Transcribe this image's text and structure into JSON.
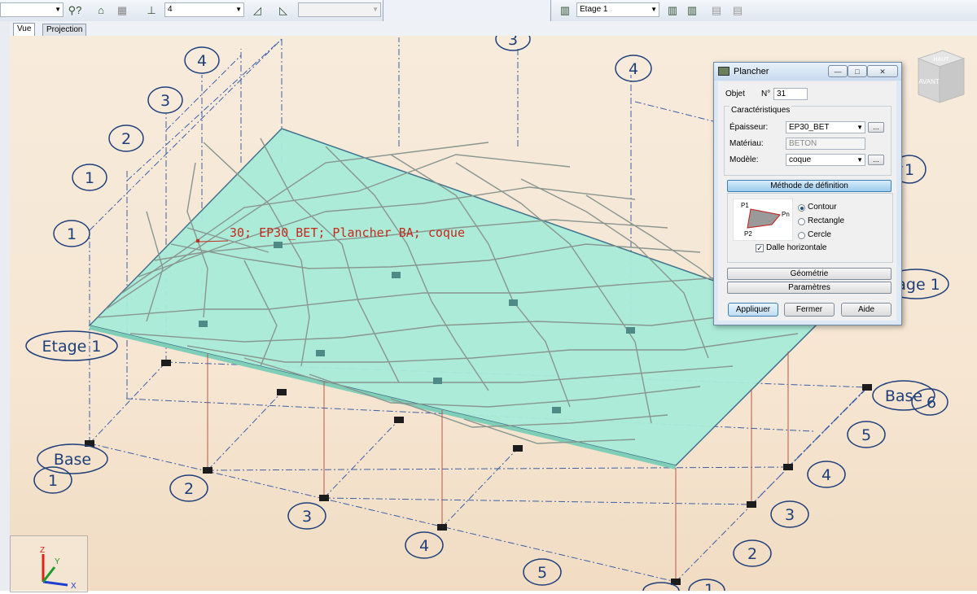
{
  "toolbar": {
    "floor_count": "4",
    "level_select": "Etage 1"
  },
  "tabs": {
    "vue": "Vue",
    "projection": "Projection"
  },
  "scene": {
    "annotation": "30; EP30_BET; Plancher BA; coque",
    "bubbles": {
      "b1": "1",
      "b2": "2",
      "b3": "3",
      "b4": "4",
      "b5": "5",
      "b6": "6",
      "base": "Base",
      "etage1": "Etage 1",
      "age1": "age 1"
    }
  },
  "view_cube": {
    "top": "HAUT",
    "front": "AVANT"
  },
  "axes": {
    "x": "X",
    "y": "Y",
    "z": "Z"
  },
  "dialog": {
    "title": "Plancher",
    "objet_label": "Objet",
    "num_label": "N°",
    "num_value": "31",
    "carac_title": "Caractéristiques",
    "epaisseur_label": "Épaisseur:",
    "epaisseur_value": "EP30_BET",
    "materiau_label": "Matériau:",
    "materiau_value": "BETON",
    "modele_label": "Modèle:",
    "modele_value": "coque",
    "dots": "...",
    "methode": "Méthode de définition",
    "contour": "Contour",
    "rectangle": "Rectangle",
    "cercle": "Cercle",
    "dalle": "Dalle horizontale",
    "p1": "P1",
    "p2": "P2",
    "pn": "Pn",
    "geometrie": "Géométrie",
    "parametres": "Paramètres",
    "appliquer": "Appliquer",
    "fermer": "Fermer",
    "aide": "Aide"
  },
  "colors": {
    "slab": "#a8ecd8",
    "mesh": "#8a9690",
    "bubble": "#1f3f7a",
    "label": "#c42a1e"
  }
}
